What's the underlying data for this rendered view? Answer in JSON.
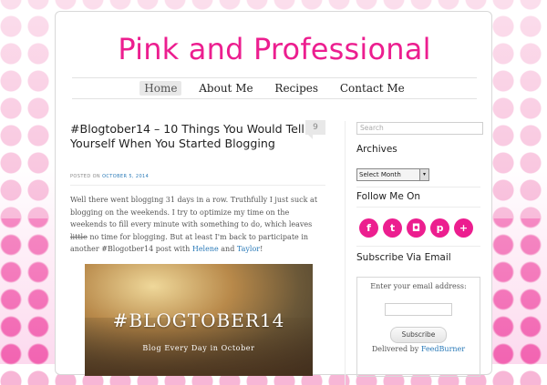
{
  "site": {
    "title": "Pink and Professional"
  },
  "nav": {
    "items": [
      "Home",
      "About Me",
      "Recipes",
      "Contact Me"
    ],
    "active": "Home"
  },
  "post": {
    "title": "#Blogtober14 – 10 Things You Would Tell Yourself When You Started Blogging",
    "comments": "9",
    "posted_on_label": "POSTED ON",
    "date": "OCTOBER 5, 2014",
    "body": {
      "part1": "Well there went blogging 31 days in a row. Truthfully I just suck at blogging on the weekends. I try to optimize my time on the weekends to fill every minute with something to do, which leaves ",
      "struck": "little",
      "part2": " no time for blogging. But at least I'm back to participate in another #Blogotber14 post with ",
      "link1": "Helene",
      "and": " and ",
      "link2": "Taylor",
      "end": "!"
    },
    "image": {
      "title": "#BLOGTOBER14",
      "subtitle": "Blog Every Day in October"
    }
  },
  "sidebar": {
    "search_placeholder": "Search",
    "archives_title": "Archives",
    "archives_select": "Select Month",
    "follow_title": "Follow Me On",
    "social_icons": [
      "facebook-icon",
      "twitter-icon",
      "instagram-icon",
      "pinterest-icon",
      "google-plus-icon"
    ],
    "subscribe_title": "Subscribe Via Email",
    "subscribe_label": "Enter your email address:",
    "subscribe_button": "Subscribe",
    "delivered_by": "Delivered by ",
    "feedburner": "FeedBurner"
  },
  "colors": {
    "brand": "#ec1e8f",
    "link": "#2a7ab8"
  }
}
